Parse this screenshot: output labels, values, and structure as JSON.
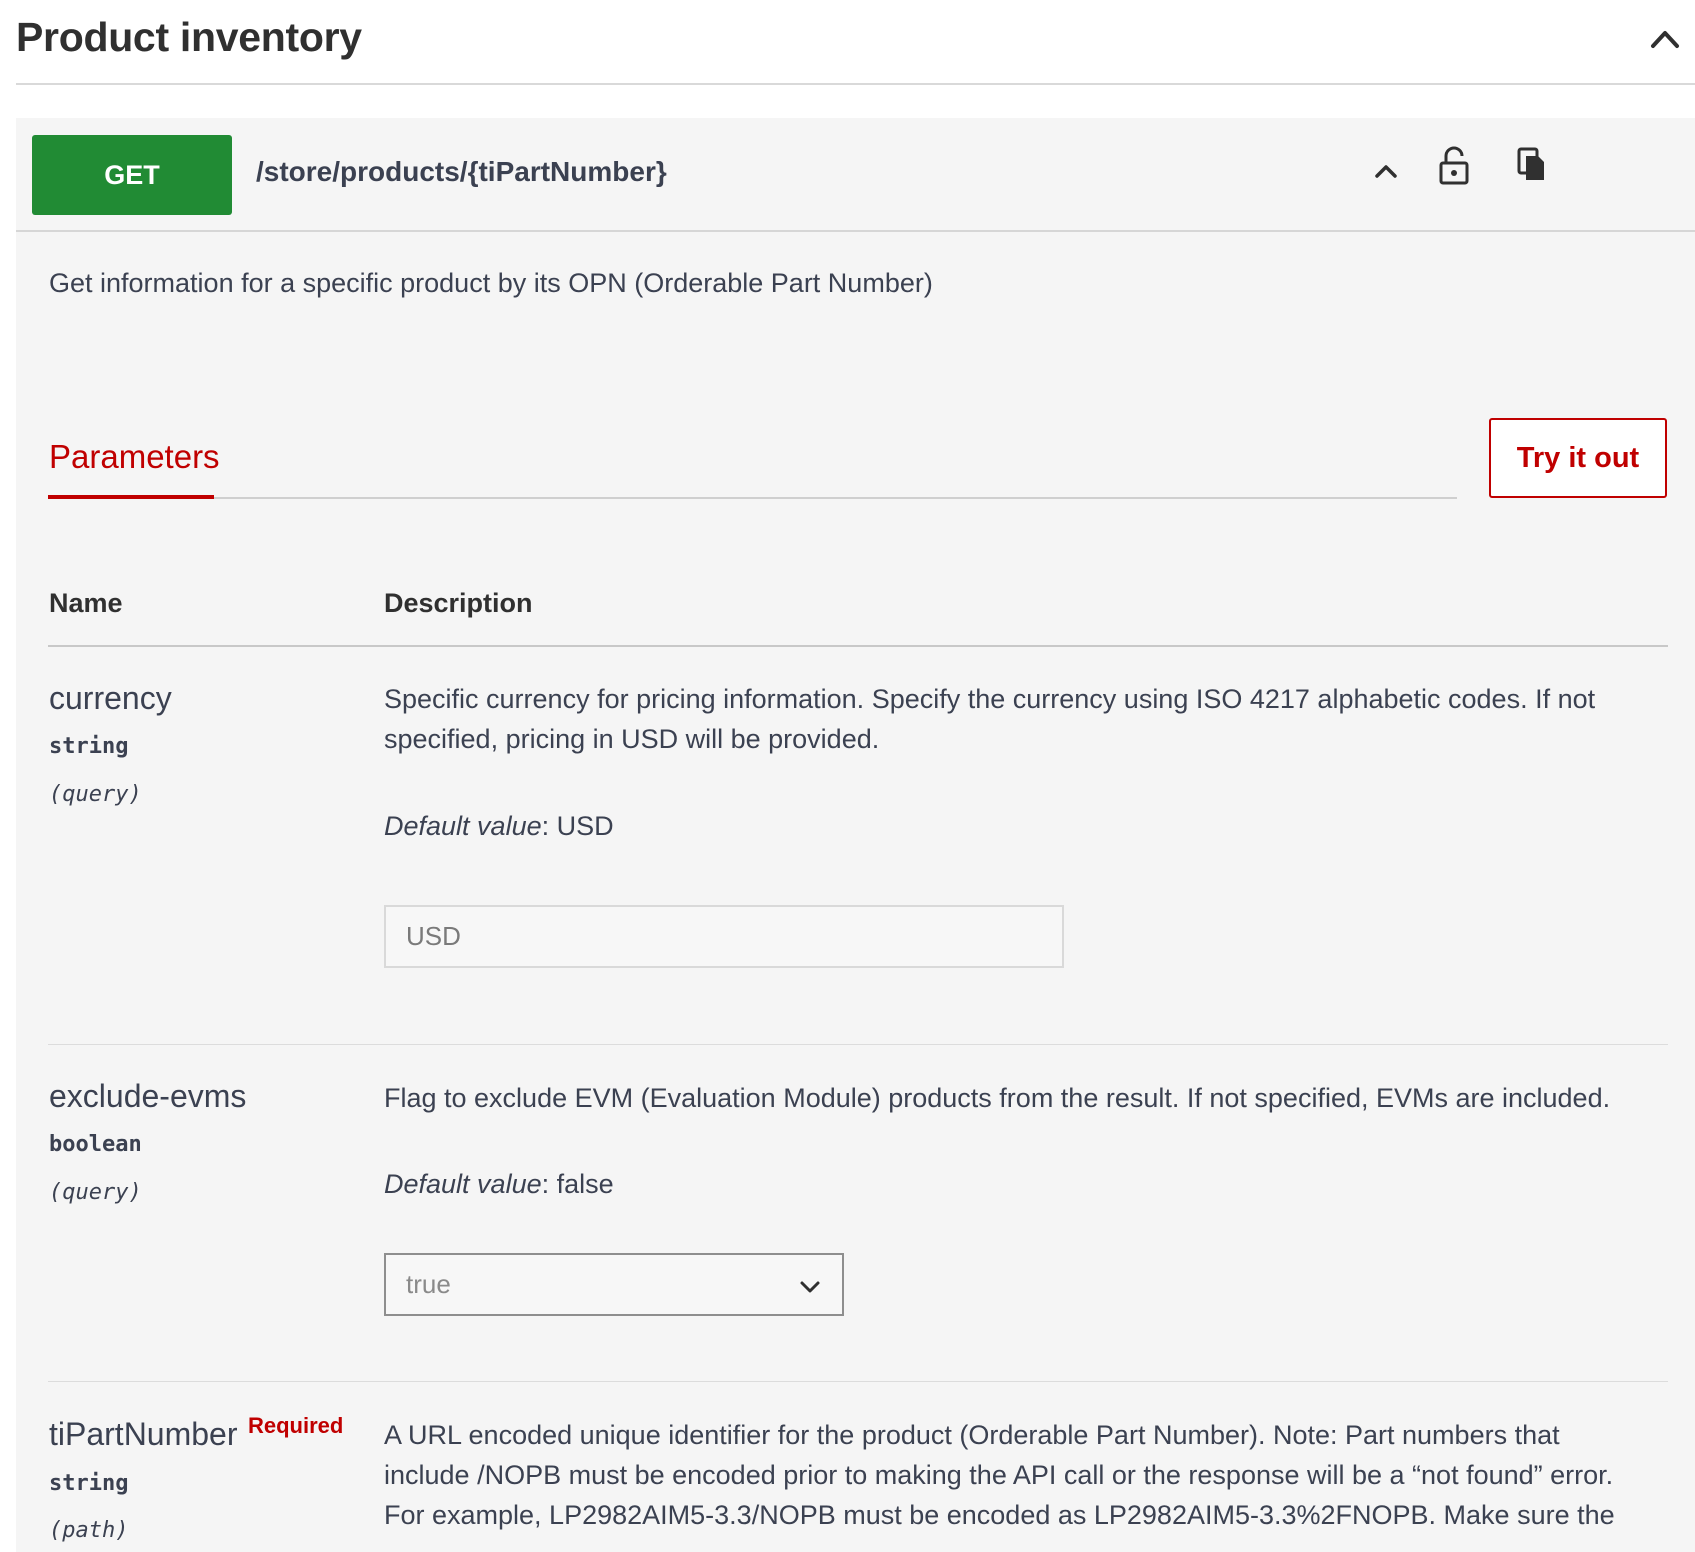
{
  "section": {
    "title": "Product inventory",
    "toggle_icon": "chevron-up-icon"
  },
  "operation": {
    "method": "GET",
    "method_color": "#218b34",
    "path": "/store/products/{tiPartNumber}",
    "description": "Get information for a specific product by its OPN (Orderable Part Number)",
    "icons": [
      "chevron-up-icon",
      "unlock-icon",
      "copy-icon"
    ]
  },
  "tabs": {
    "parameters_label": "Parameters",
    "accent_color": "#c00000"
  },
  "try_button": {
    "label": "Try it out"
  },
  "table": {
    "headers": {
      "name": "Name",
      "description": "Description"
    },
    "params": [
      {
        "name": "currency",
        "type": "string",
        "in": "(query)",
        "description_line1": "Specific currency for pricing information. Specify the currency using ISO 4217 alphabetic codes. If not",
        "description_line2": "specified, pricing in USD will be provided.",
        "default_label": "Default value",
        "default_value": ": USD",
        "input_value": "USD"
      },
      {
        "name": "exclude-evms",
        "type": "boolean",
        "in": "(query)",
        "description_line1": "Flag to exclude EVM (Evaluation Module) products from the result. If not specified, EVMs are included.",
        "default_label": "Default value",
        "default_value": ": false",
        "select_value": "true"
      },
      {
        "name": "tiPartNumber",
        "required_label": "Required",
        "type": "string",
        "in": "(path)",
        "description_line1": "A URL encoded unique identifier for the product (Orderable Part Number). Note: Part numbers that",
        "description_line2": "include /NOPB must be encoded prior to making the API call or the response will be a “not found” error.",
        "description_line3": "For example, LP2982AIM5-3.3/NOPB must be encoded as LP2982AIM5-3.3%2FNOPB. Make sure the"
      }
    ]
  }
}
